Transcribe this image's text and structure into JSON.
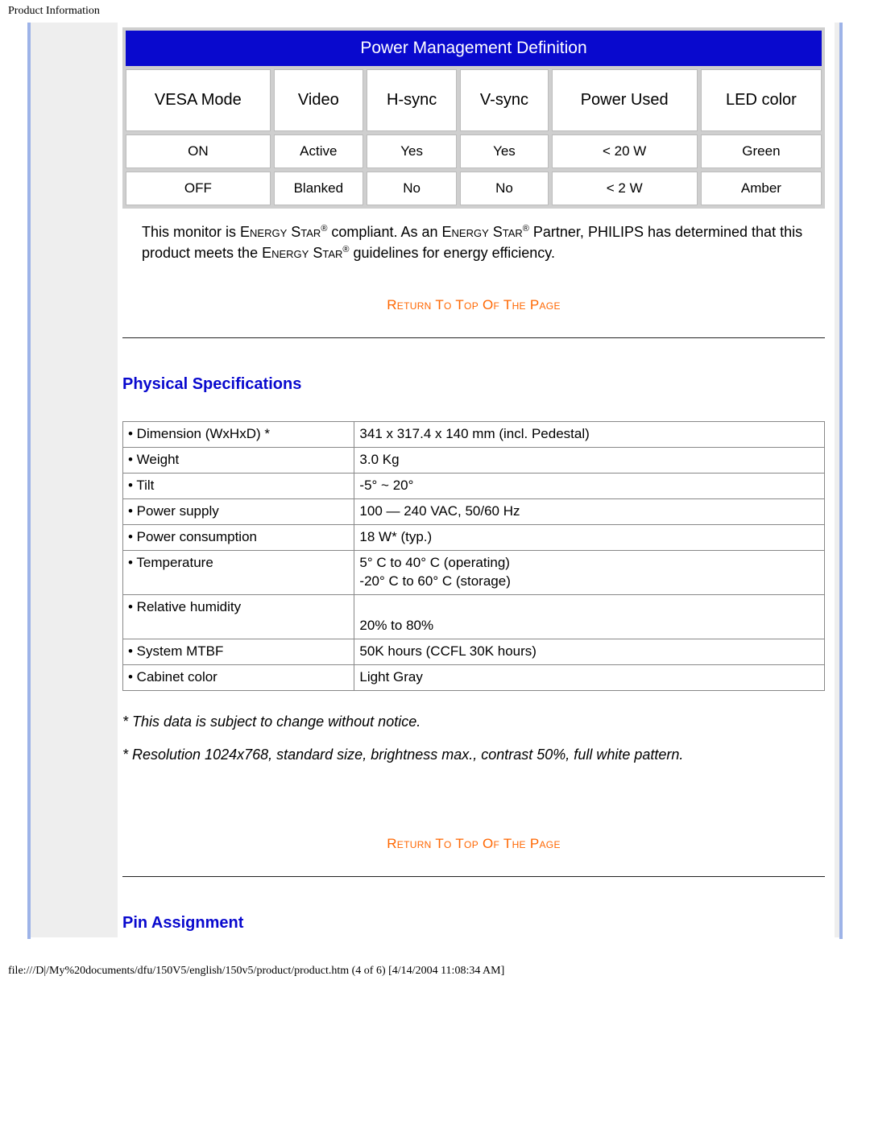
{
  "header": {
    "title": "Product Information"
  },
  "power_mgmt": {
    "title": "Power Management Definition",
    "columns": [
      "VESA Mode",
      "Video",
      "H-sync",
      "V-sync",
      "Power Used",
      "LED color"
    ],
    "rows": [
      [
        "ON",
        "Active",
        "Yes",
        "Yes",
        "< 20 W",
        "Green"
      ],
      [
        "OFF",
        "Blanked",
        "No",
        "No",
        "< 2 W",
        "Amber"
      ]
    ]
  },
  "compliance": {
    "pre1": "This monitor is ",
    "brand1": "Energy Star",
    "reg": "®",
    "mid1": " compliant. As an ",
    "brand2": "Energy Star",
    "mid2": " Partner, ",
    "company": "PHILIPS",
    "mid3": " has determined that this product meets the ",
    "brand3": "Energy Star",
    "post": " guidelines for energy efficiency."
  },
  "links": {
    "return_top": "Return To Top Of The Page"
  },
  "sections": {
    "physical": "Physical Specifications",
    "pin": "Pin Assignment"
  },
  "specs": {
    "rows": [
      {
        "label": "• Dimension (WxHxD) *",
        "value": "341 x 317.4 x 140 mm (incl. Pedestal)"
      },
      {
        "label": "• Weight",
        "value": "3.0 Kg"
      },
      {
        "label": "• Tilt",
        "value": "-5° ~ 20°"
      },
      {
        "label": "• Power supply",
        "value": "100 — 240 VAC, 50/60 Hz"
      },
      {
        "label": "• Power consumption",
        "value": "18 W* (typ.)"
      },
      {
        "label": "• Temperature",
        "value": "5° C to 40° C (operating)\n-20° C to 60° C (storage)"
      },
      {
        "label": "• Relative humidity",
        "value": "\n20% to 80%\n "
      },
      {
        "label": "• System MTBF",
        "value": "50K hours (CCFL 30K hours)"
      },
      {
        "label": "• Cabinet color",
        "value": "Light Gray"
      }
    ]
  },
  "footnotes": {
    "f1": "* This data is subject to change without notice.",
    "f2": "* Resolution 1024x768, standard size, brightness max., contrast 50%, full white pattern."
  },
  "footer": {
    "path": "file:///D|/My%20documents/dfu/150V5/english/150v5/product/product.htm (4 of 6) [4/14/2004 11:08:34 AM]"
  }
}
